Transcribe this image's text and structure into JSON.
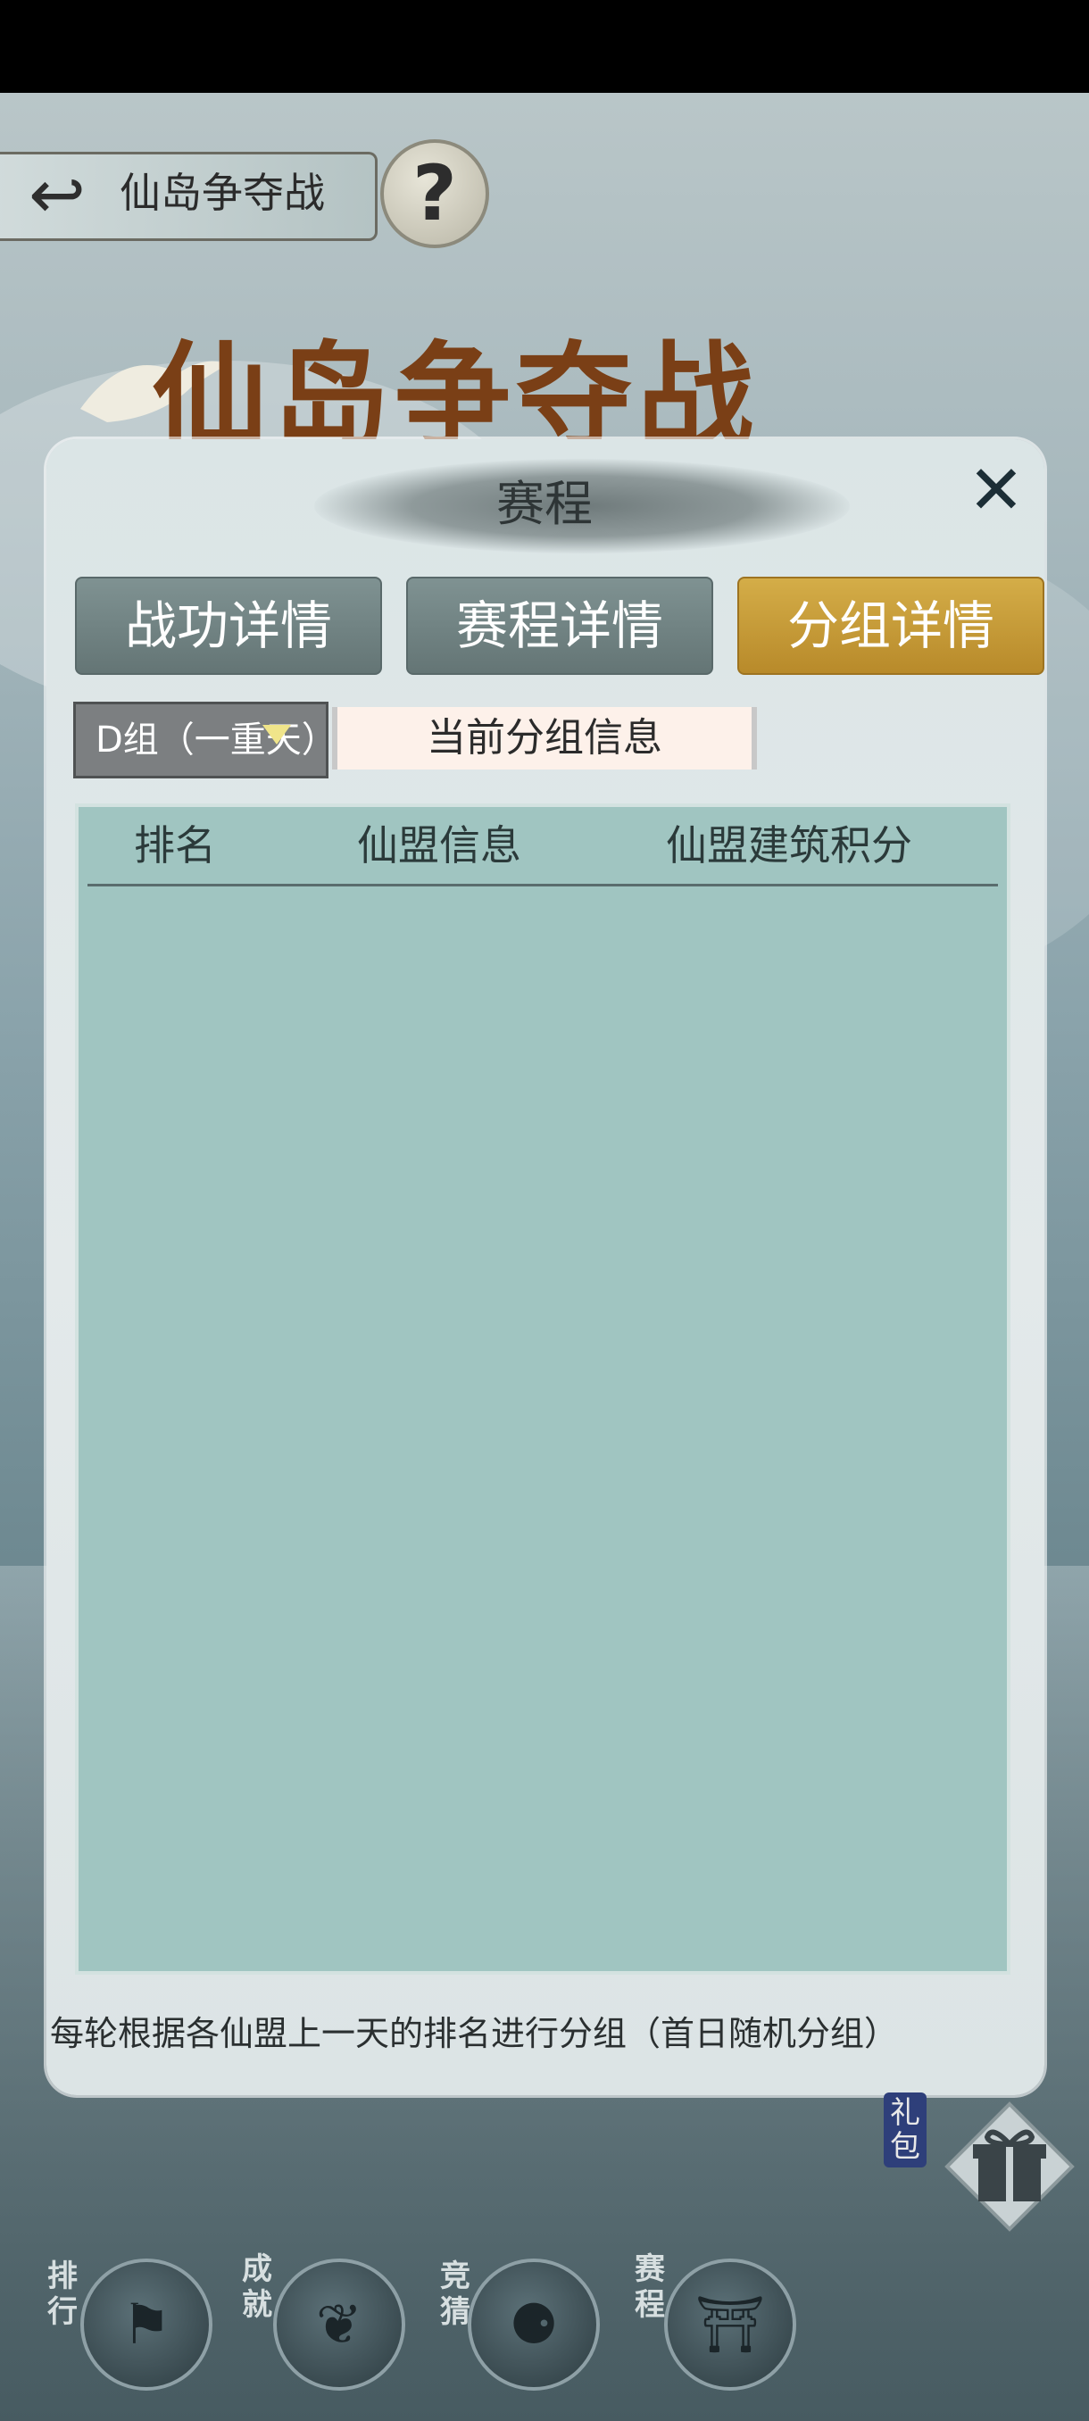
{
  "nav": {
    "back_title": "仙岛争夺战",
    "help_glyph": "?",
    "banner": "仙岛争夺战"
  },
  "dialog": {
    "title": "赛程",
    "close_glyph": "✕",
    "tabs": [
      {
        "label": "战功详情",
        "active": false
      },
      {
        "label": "赛程详情",
        "active": false
      },
      {
        "label": "分组详情",
        "active": true
      }
    ],
    "group_select": {
      "value": "D组（一重天）"
    },
    "group_info_label": "当前分组信息",
    "table": {
      "headers": [
        "排名",
        "仙盟信息",
        "仙盟建筑积分"
      ],
      "rows": []
    },
    "footnote": "每轮根据各仙盟上一天的排名进行分组（首日随机分组）"
  },
  "side": {
    "gift_label": "礼包"
  },
  "bottom_bar": [
    {
      "label": "排行",
      "icon": "banner-icon"
    },
    {
      "label": "成就",
      "icon": "scroll-icon"
    },
    {
      "label": "竞猜",
      "icon": "dice-icon"
    },
    {
      "label": "赛程",
      "icon": "flag-icon"
    }
  ],
  "colors": {
    "active_tab": "#c79a34",
    "inactive_tab": "#728585",
    "table_bg": "#a0c5c1",
    "dialog_bg": "#e0e7e8"
  }
}
